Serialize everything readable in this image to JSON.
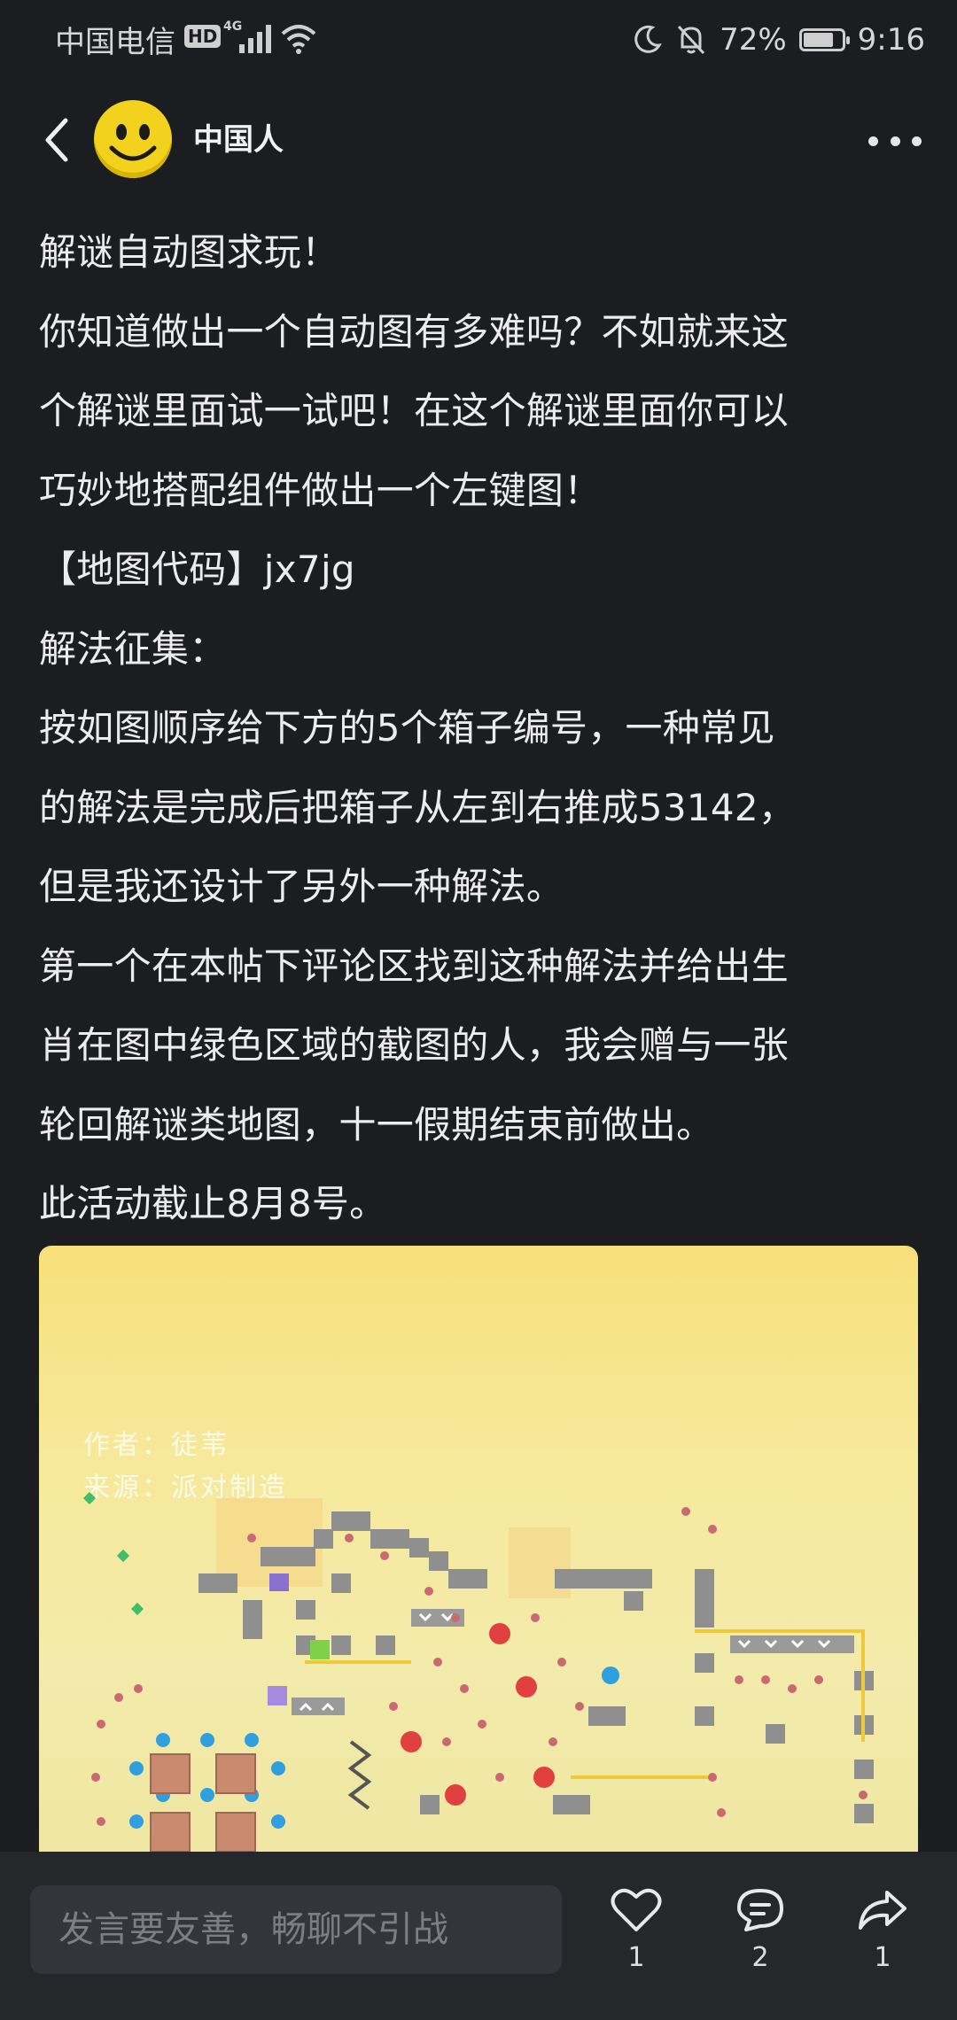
{
  "status_bar": {
    "carrier": "中国电信",
    "hd": "HD",
    "network": "4G",
    "battery_percent": "72%",
    "time": "9:16",
    "icons": [
      "wifi-icon",
      "moon-icon",
      "mute-bell-icon",
      "battery-icon"
    ]
  },
  "header": {
    "username": "中国人",
    "back_icon": "chevron-left-icon",
    "more_icon": "more-dots-icon",
    "avatar": "smiley-avatar"
  },
  "post": {
    "lines": [
      "解谜自动图求玩！",
      "你知道做出一个自动图有多难吗？不如就来这",
      "个解谜里面试一试吧！在这个解谜里面你可以",
      "巧妙地搭配组件做出一个左键图！",
      "【地图代码】jx7jg",
      "解法征集：",
      "按如图顺序给下方的5个箱子编号，一种常见",
      "的解法是完成后把箱子从左到右推成53142，",
      "但是我还设计了另外一种解法。",
      "第一个在本帖下评论区找到这种解法并给出生",
      "肖在图中绿色区域的截图的人，我会赠与一张",
      "轮回解谜类地图，十一假期结束前做出。",
      "此活动截止8月8号。"
    ],
    "image": {
      "watermark_author": "作者：徒苇",
      "watermark_source": "来源：派对制造"
    }
  },
  "bottom_bar": {
    "input_placeholder": "发言要友善，畅聊不引战",
    "like_count": "1",
    "comment_count": "2",
    "share_count": "1"
  },
  "colors": {
    "background": "#1c1d21",
    "bottom_bar": "#26272b",
    "input_bg": "#34353a",
    "avatar": "#f2d21c"
  }
}
